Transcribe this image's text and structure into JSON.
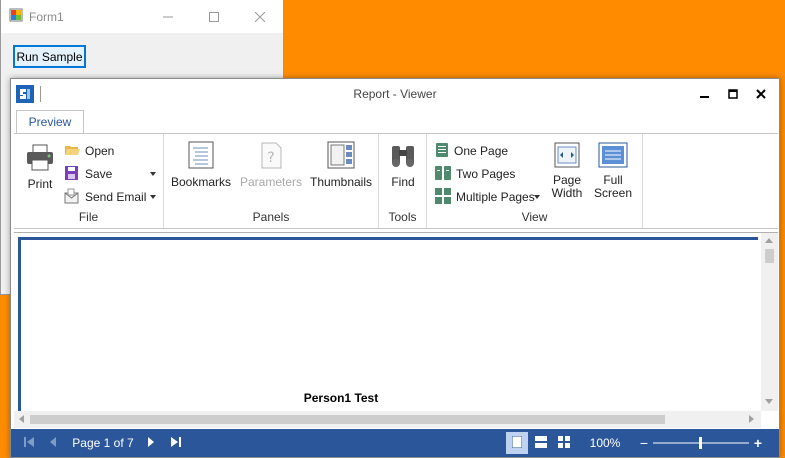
{
  "form1": {
    "title": "Form1",
    "run_button_label": "Run Sample"
  },
  "viewer": {
    "title": "Report - Viewer",
    "tabs": [
      {
        "label": "Preview",
        "active": true
      }
    ],
    "groups": {
      "file": {
        "label": "File",
        "print_label": "Print",
        "open_label": "Open",
        "save_label": "Save",
        "send_email_label": "Send Email"
      },
      "panels": {
        "label": "Panels",
        "bookmarks_label": "Bookmarks",
        "parameters_label": "Parameters",
        "thumbnails_label": "Thumbnails"
      },
      "tools": {
        "label": "Tools",
        "find_label": "Find"
      },
      "view": {
        "label": "View",
        "one_page_label": "One Page",
        "two_pages_label": "Two Pages",
        "multiple_pages_label": "Multiple Pages",
        "page_width_line1": "Page",
        "page_width_line2": "Width",
        "full_screen_line1": "Full",
        "full_screen_line2": "Screen"
      }
    },
    "report": {
      "content_text": "Person1 Test"
    },
    "statusbar": {
      "page_info": "Page 1 of 7",
      "zoom": "100%",
      "zoom_minus": "−",
      "zoom_plus": "+"
    },
    "colors": {
      "accent": "#2B579A",
      "desktop": "#FF8C00",
      "button_highlight": "#0078D7"
    }
  }
}
